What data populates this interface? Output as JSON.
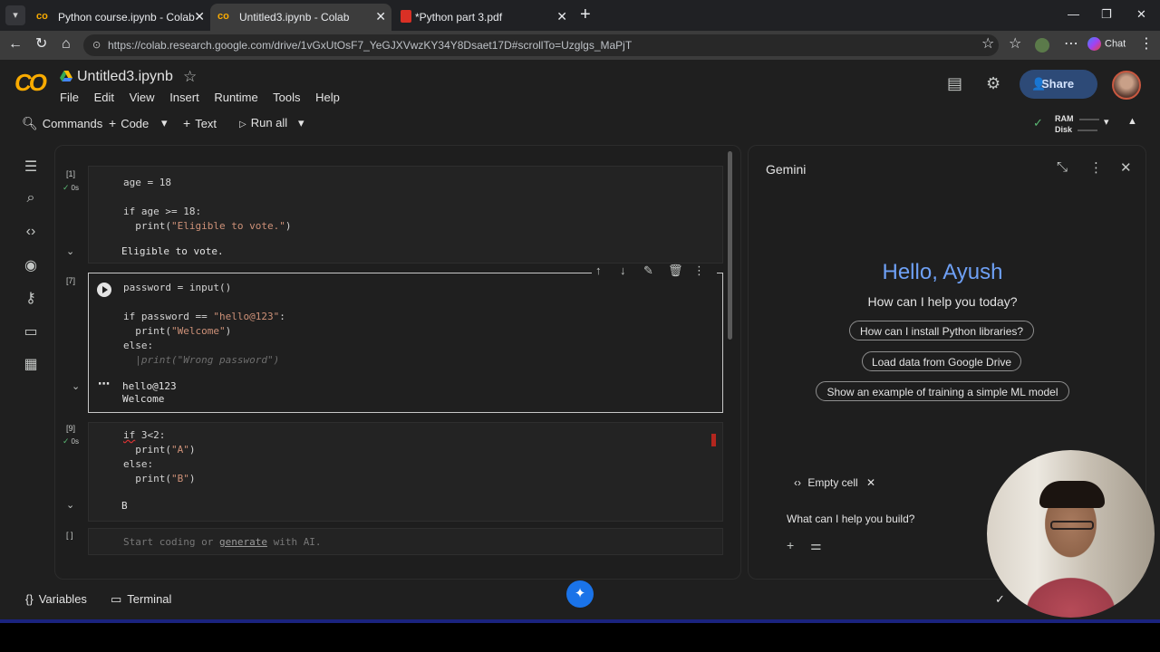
{
  "browser": {
    "tabs": [
      {
        "title": "Python course.ipynb - Colab",
        "active": false
      },
      {
        "title": "Untitled3.ipynb - Colab",
        "active": true
      },
      {
        "title": "*Python part 3.pdf",
        "active": false
      }
    ],
    "url": "https://colab.research.google.com/drive/1vGxUtOsF7_YeGJXVwzKY34Y8Dsaet17D#scrollTo=Uzglgs_MaPjT",
    "chat_label": "Chat"
  },
  "colab": {
    "notebook_title": "Untitled3.ipynb",
    "menu": [
      "File",
      "Edit",
      "View",
      "Insert",
      "Runtime",
      "Tools",
      "Help"
    ],
    "share_label": "Share",
    "toolbar": {
      "commands": "Commands",
      "code": "Code",
      "text": "Text",
      "run_all": "Run all",
      "ram_label": "RAM",
      "disk_label": "Disk"
    }
  },
  "cells": [
    {
      "count": "[1]",
      "status": "0s",
      "code_lines": [
        "age = 18",
        "",
        "if age >= 18:",
        "  print(\"Eligible to vote.\")"
      ],
      "output": "Eligible to vote."
    },
    {
      "count": "[7]",
      "code_lines": [
        "password = input()",
        "",
        "if password == \"hello@123\":",
        "  print(\"Welcome\")",
        "else:",
        "  print(\"Wrong password\")"
      ],
      "output_lines": [
        "hello@123",
        "Welcome"
      ]
    },
    {
      "count": "[9]",
      "status": "0s",
      "code_lines": [
        "if 3<2:",
        "  print(\"A\")",
        "else:",
        "  print(\"B\")"
      ],
      "output": "B"
    },
    {
      "count": "[ ]",
      "placeholder_pre": "Start coding or ",
      "placeholder_link": "generate",
      "placeholder_post": " with AI."
    }
  ],
  "gemini": {
    "title": "Gemini",
    "greeting": "Hello, Ayush",
    "subtitle": "How can I help you today?",
    "suggestions": [
      "How can I install Python libraries?",
      "Load data from Google Drive",
      "Show an example of training a simple ML model"
    ],
    "context_chip": "Empty cell",
    "prompt_placeholder": "What can I help you build?"
  },
  "statusbar": {
    "variables": "Variables",
    "terminal": "Terminal"
  }
}
